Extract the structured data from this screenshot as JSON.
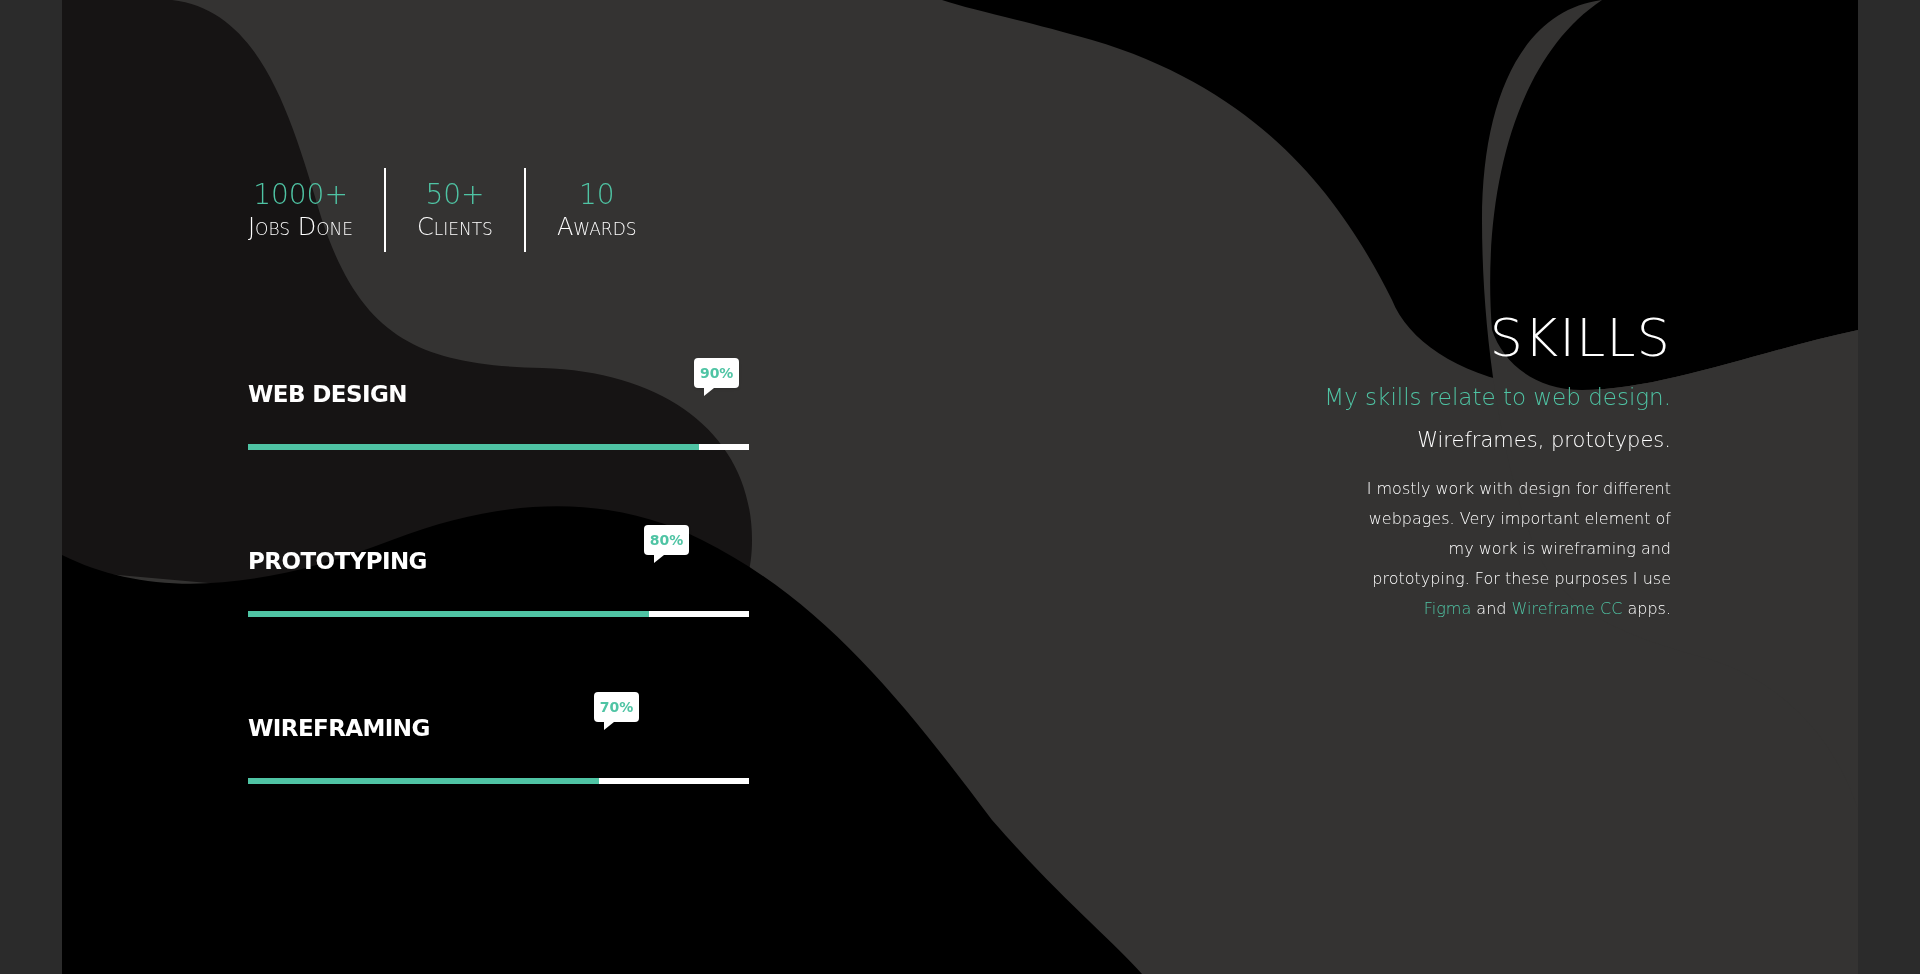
{
  "stats": [
    {
      "value": "1000+",
      "label": "Jobs Done"
    },
    {
      "value": "50+",
      "label": "Clients"
    },
    {
      "value": "10",
      "label": "Awards"
    }
  ],
  "skills": [
    {
      "name": "WEB DESIGN",
      "level": 0.9,
      "reading": "90%"
    },
    {
      "name": "PROTOTYPING",
      "level": 0.8,
      "reading": "80%"
    },
    {
      "name": "WIREFRAMING",
      "level": 0.7,
      "reading": "70%"
    }
  ],
  "heading": "SKILLS",
  "tagline": "My skills relate to web design.",
  "subtitle": "Wireframes, prototypes.",
  "paragraph": [
    {
      "kind": "text",
      "text": "I mostly work with design for different webpages. Very important element of my work is wireframing and prototyping. For these purposes I use "
    },
    {
      "kind": "link",
      "text": "Figma"
    },
    {
      "kind": "text",
      "text": " and "
    },
    {
      "kind": "link",
      "text": "Wireframe CC"
    },
    {
      "kind": "text",
      "text": " apps."
    }
  ]
}
